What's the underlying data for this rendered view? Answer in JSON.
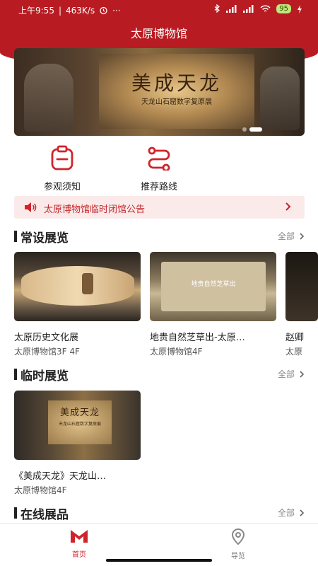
{
  "status": {
    "time": "上午9:55",
    "speed": "463K/s",
    "more": "···",
    "battery": "95"
  },
  "app": {
    "title": "太原博物馆"
  },
  "banner": {
    "title": "美成天龙",
    "subtitle": "天龙山石窟数字复原展"
  },
  "quick_links": [
    {
      "label": "参观须知",
      "icon": "clipboard-icon"
    },
    {
      "label": "推荐路线",
      "icon": "route-icon"
    }
  ],
  "notice": {
    "text": "太原博物馆临时闭馆公告"
  },
  "sections": {
    "permanent": {
      "title": "常设展览",
      "more": "全部",
      "items": [
        {
          "name": "太原历史文化展",
          "location": "太原博物馆3F 4F"
        },
        {
          "name": "地贵自然芝草出-太原…",
          "location": "太原博物馆4F",
          "image_text": "地贵自然芝草出"
        },
        {
          "name": "赵卿",
          "location": "太原"
        }
      ]
    },
    "temporary": {
      "title": "临时展览",
      "more": "全部",
      "items": [
        {
          "name": "《美成天龙》天龙山…",
          "location": "太原博物馆4F",
          "image_title": "美成天龙",
          "image_subtitle": "天龙山石窟数字复原展"
        }
      ]
    },
    "online": {
      "title": "在线展品",
      "more": "全部"
    }
  },
  "tabbar": [
    {
      "label": "首页",
      "active": true
    },
    {
      "label": "导览",
      "active": false
    }
  ],
  "colors": {
    "brand_red": "#b81c22",
    "notice_bg": "#fbeaea",
    "notice_text": "#c4262b"
  }
}
